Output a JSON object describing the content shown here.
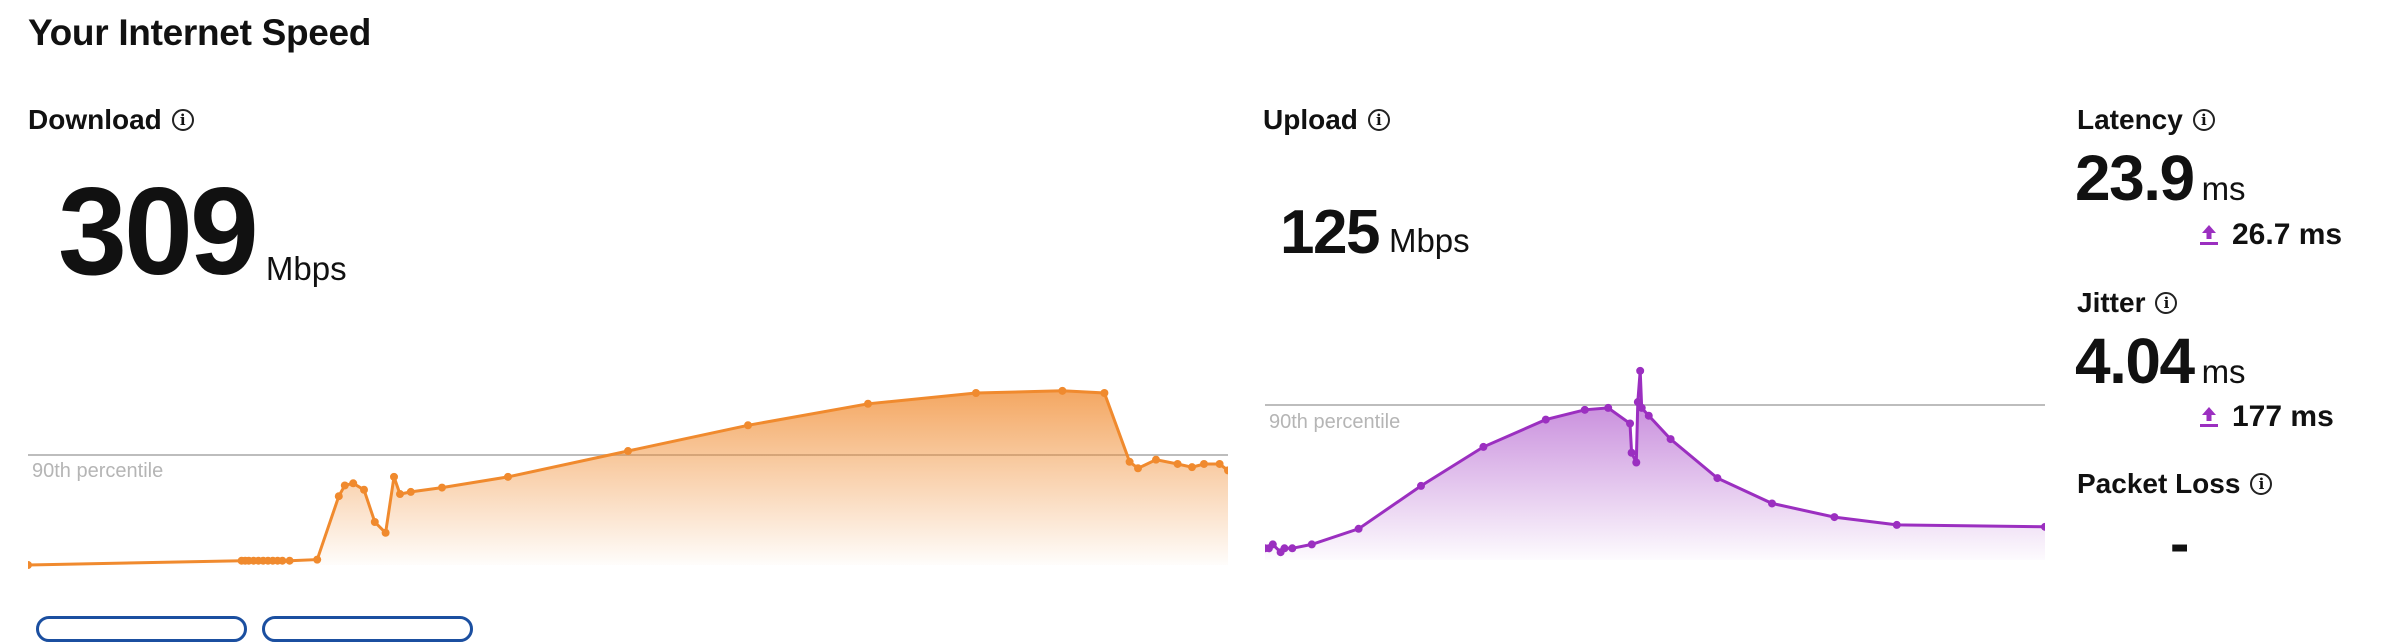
{
  "page": {
    "title": "Your Internet Speed"
  },
  "download": {
    "label": "Download",
    "value": "309",
    "unit": "Mbps"
  },
  "upload": {
    "label": "Upload",
    "value": "125",
    "unit": "Mbps"
  },
  "latency": {
    "label": "Latency",
    "value": "23.9",
    "unit": "ms",
    "upload_value": "26.7 ms"
  },
  "jitter": {
    "label": "Jitter",
    "value": "4.04",
    "unit": "ms",
    "upload_value": "177 ms"
  },
  "packet_loss": {
    "label": "Packet Loss",
    "value": "-"
  },
  "icons": {
    "info": "info-icon",
    "upload": "upload-arrow-icon"
  },
  "colors": {
    "download": "#f08a2e",
    "upload": "#9b2fc0",
    "percentile_line": "#bdbdbd"
  },
  "chart_data": [
    {
      "type": "area",
      "name": "download-chart",
      "percentile_label": "90th percentile",
      "percentile_value": 0.5,
      "x": [
        0.0,
        0.178,
        0.181,
        0.184,
        0.188,
        0.192,
        0.196,
        0.2,
        0.204,
        0.208,
        0.212,
        0.218,
        0.241,
        0.259,
        0.264,
        0.271,
        0.28,
        0.289,
        0.298,
        0.305,
        0.31,
        0.319,
        0.345,
        0.4,
        0.5,
        0.6,
        0.7,
        0.79,
        0.862,
        0.897,
        0.918,
        0.925,
        0.94,
        0.958,
        0.97,
        0.98,
        0.993,
        1.0
      ],
      "y": [
        0.0,
        0.02,
        0.02,
        0.02,
        0.02,
        0.02,
        0.02,
        0.02,
        0.02,
        0.02,
        0.02,
        0.02,
        0.025,
        0.32,
        0.37,
        0.38,
        0.35,
        0.2,
        0.15,
        0.41,
        0.33,
        0.34,
        0.36,
        0.41,
        0.53,
        0.65,
        0.75,
        0.8,
        0.81,
        0.8,
        0.48,
        0.45,
        0.49,
        0.47,
        0.455,
        0.47,
        0.47,
        0.44
      ]
    },
    {
      "type": "area",
      "name": "upload-chart",
      "percentile_label": "90th percentile",
      "percentile_value": 0.74,
      "x": [
        0.0,
        0.005,
        0.01,
        0.02,
        0.025,
        0.035,
        0.06,
        0.12,
        0.2,
        0.28,
        0.36,
        0.41,
        0.44,
        0.468,
        0.47,
        0.476,
        0.478,
        0.481,
        0.483,
        0.492,
        0.52,
        0.58,
        0.65,
        0.73,
        0.81,
        1.0
      ],
      "y": [
        0.06,
        0.06,
        0.08,
        0.04,
        0.06,
        0.06,
        0.08,
        0.16,
        0.38,
        0.58,
        0.72,
        0.77,
        0.78,
        0.7,
        0.55,
        0.5,
        0.81,
        0.97,
        0.78,
        0.74,
        0.62,
        0.42,
        0.29,
        0.22,
        0.18,
        0.17
      ]
    }
  ]
}
